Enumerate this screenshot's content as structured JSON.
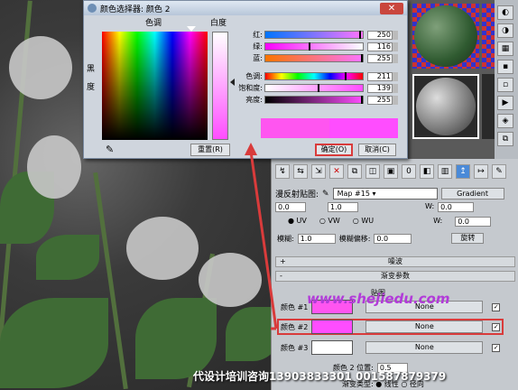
{
  "dialog": {
    "title": "颜色选择器: 颜色 2",
    "close_symbol": "✕",
    "labels": {
      "hue": "色调",
      "white": "白度",
      "black": "黑",
      "dud": "度"
    },
    "sliders": [
      {
        "name": "红:",
        "value": "250",
        "fill": 0.98
      },
      {
        "name": "绿:",
        "value": "116",
        "fill": 0.45
      },
      {
        "name": "蓝:",
        "value": "255",
        "fill": 1.0
      },
      {
        "name": "色调:",
        "value": "211",
        "fill": 0.83
      },
      {
        "name": "饱和度:",
        "value": "139",
        "fill": 0.55
      },
      {
        "name": "亮度:",
        "value": "255",
        "fill": 1.0
      }
    ],
    "reset_label": "重置(R)",
    "ok_label": "确定(O)",
    "cancel_label": "取消(C)"
  },
  "panel": {
    "map_label": "漫反射贴图:",
    "map_name": "Map #15",
    "gradient_label": "Gradient",
    "coords": {
      "u": "0.0",
      "v": "1.0",
      "w": "0.0",
      "w2": "0.0",
      "w_label": "W:",
      "v_label": "V:"
    },
    "radios": [
      "UV",
      "VW",
      "WU"
    ],
    "blur_label": "模糊:",
    "blur_value": "1.0",
    "blur_offset_label": "模糊偏移:",
    "blur_offset_value": "0.0",
    "rotate_label": "旋转",
    "noise_rollout": "噪波",
    "gradient_params_rollout": "渐变参数",
    "maps_label": "贴图",
    "colors": [
      {
        "label": "颜色 #1",
        "swatch": "#ff55f0",
        "map": "None"
      },
      {
        "label": "颜色 #2",
        "swatch": "#ff4dff",
        "map": "None"
      },
      {
        "label": "颜色 #3",
        "swatch": "#ffffff",
        "map": "None"
      }
    ],
    "pos_label": "颜色 2 位置:",
    "pos_value": "0.5",
    "gradtype_label": "渐变类型:",
    "gradtype_opts": [
      "线性",
      "径向"
    ]
  },
  "watermark": "www.shejiedu.com",
  "bottom_text": "代设计培训咨询13903833301  001587879379",
  "accent": "#d93b3b",
  "pink": "#ff4dff"
}
